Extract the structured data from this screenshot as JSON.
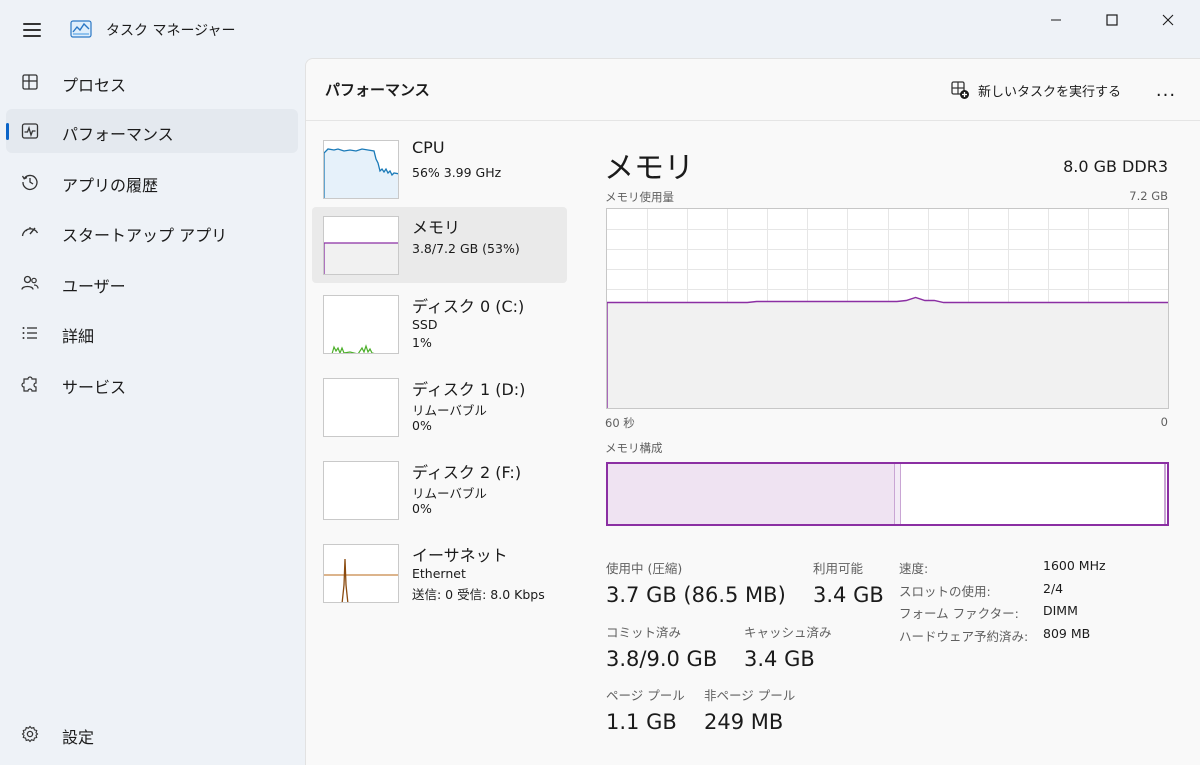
{
  "app": {
    "title": "タスク マネージャー"
  },
  "nav": {
    "items": [
      {
        "label": "プロセス",
        "icon": "grid-icon"
      },
      {
        "label": "パフォーマンス",
        "icon": "performance-icon",
        "active": true
      },
      {
        "label": "アプリの履歴",
        "icon": "history-icon"
      },
      {
        "label": "スタートアップ アプリ",
        "icon": "speedometer-icon"
      },
      {
        "label": "ユーザー",
        "icon": "users-icon"
      },
      {
        "label": "詳細",
        "icon": "list-icon"
      },
      {
        "label": "サービス",
        "icon": "puzzle-icon"
      }
    ],
    "settings_label": "設定"
  },
  "header": {
    "title": "パフォーマンス",
    "run_task_label": "新しいタスクを実行する",
    "more_label": "..."
  },
  "perf_list": [
    {
      "name": "CPU",
      "lines": [
        "56%  3.99 GHz"
      ],
      "color": "#1a7ab8",
      "active": false
    },
    {
      "name": "メモリ",
      "lines": [
        "3.8/7.2 GB (53%)"
      ],
      "color": "#8b2fa3",
      "active": true
    },
    {
      "name": "ディスク 0 (C:)",
      "lines": [
        "SSD",
        "1%"
      ],
      "color": "#4caf2a",
      "active": false
    },
    {
      "name": "ディスク 1 (D:)",
      "lines": [
        "リムーバブル",
        "0%"
      ],
      "color": "#4caf2a",
      "active": false
    },
    {
      "name": "ディスク 2 (F:)",
      "lines": [
        "リムーバブル",
        "0%"
      ],
      "color": "#4caf2a",
      "active": false
    },
    {
      "name": "イーサネット",
      "lines": [
        "Ethernet",
        "送信: 0 受信: 8.0 Kbps"
      ],
      "color": "#b86a1a",
      "active": false
    }
  ],
  "detail": {
    "title": "メモリ",
    "spec": "8.0 GB DDR3",
    "usage_label": "メモリ使用量",
    "usage_max": "7.2 GB",
    "time_left": "60 秒",
    "time_right": "0",
    "composition_label": "メモリ構成",
    "usage_fraction": 0.53,
    "in_use_fraction": 0.514,
    "accent": "#8b2fa3",
    "fill": "#f1f1f1"
  },
  "stats": {
    "in_use_label": "使用中 (圧縮)",
    "in_use_value": "3.7 GB (86.5 MB)",
    "available_label": "利用可能",
    "available_value": "3.4 GB",
    "committed_label": "コミット済み",
    "committed_value": "3.8/9.0 GB",
    "cached_label": "キャッシュ済み",
    "cached_value": "3.4 GB",
    "paged_label": "ページ プール",
    "paged_value": "1.1 GB",
    "nonpaged_label": "非ページ プール",
    "nonpaged_value": "249 MB"
  },
  "specs": [
    {
      "key": "速度:",
      "value": "1600 MHz"
    },
    {
      "key": "スロットの使用:",
      "value": "2/4"
    },
    {
      "key": "フォーム ファクター:",
      "value": "DIMM"
    },
    {
      "key": "ハードウェア予約済み:",
      "value": "809 MB"
    }
  ]
}
